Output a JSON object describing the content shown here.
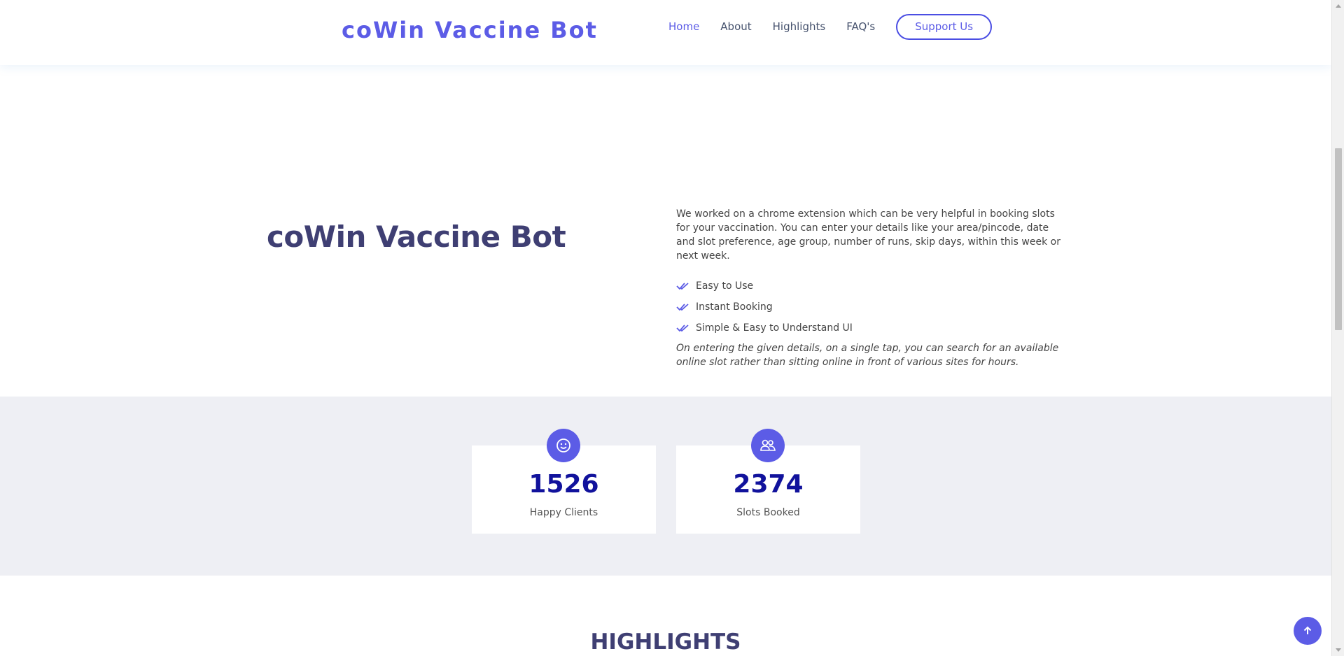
{
  "header": {
    "logo": "coWin Vaccine Bot",
    "nav": [
      {
        "label": "Home",
        "active": true
      },
      {
        "label": "About",
        "active": false
      },
      {
        "label": "Highlights",
        "active": false
      },
      {
        "label": "FAQ's",
        "active": false
      }
    ],
    "support_label": "Support Us"
  },
  "hero": {
    "title": "coWin Vaccine Bot"
  },
  "about": {
    "description": "We worked on a chrome extension which can be very helpful in booking slots for your vaccination. You can enter your details like your area/pincode, date and slot preference, age group, number of runs, skip days, within this week or next week.",
    "features": [
      "Easy to Use",
      "Instant Booking",
      "Simple & Easy to Understand UI"
    ],
    "note": "On entering the given details, on a single tap, you can search for an available online slot rather than sitting online in front of various sites for hours."
  },
  "counts": [
    {
      "value": "1526",
      "label": "Happy Clients",
      "icon": "smiley-icon"
    },
    {
      "value": "2374",
      "label": "Slots Booked",
      "icon": "users-icon"
    }
  ],
  "highlights": {
    "title": "HIGHLIGHTS"
  },
  "colors": {
    "accent": "#5c5ce6",
    "heading": "#3f3f73",
    "count_number": "#11129c",
    "counts_bg": "#eeeff4"
  }
}
